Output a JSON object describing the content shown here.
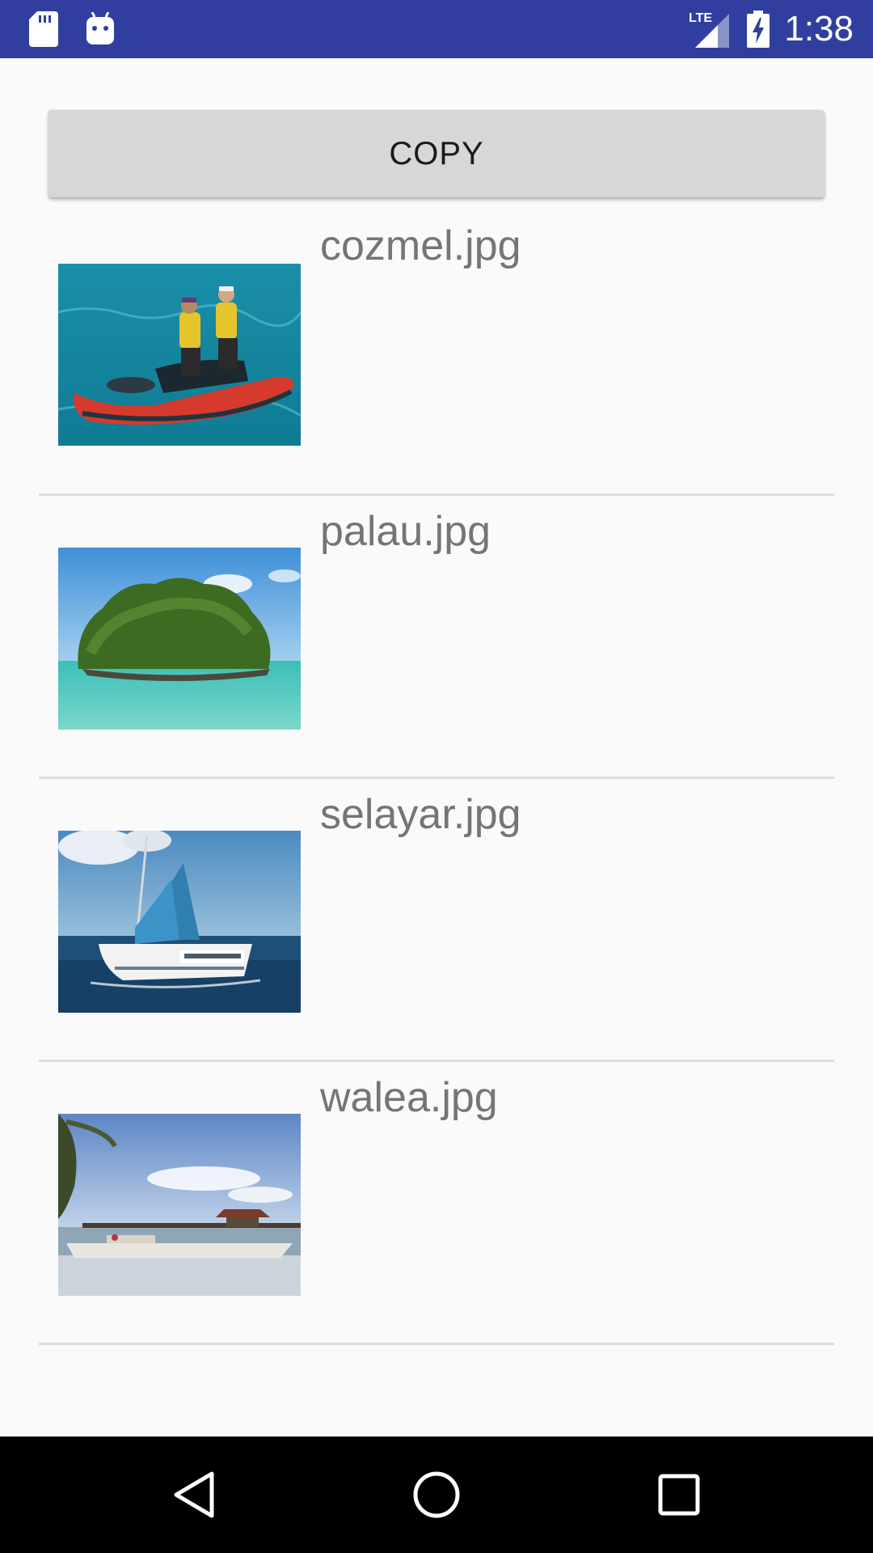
{
  "status_bar": {
    "time": "1:38",
    "network": "LTE",
    "left_icons": [
      "sd-card-icon",
      "android-debug-icon"
    ],
    "right_icons": [
      "lte-signal-icon",
      "battery-charging-icon"
    ],
    "background": "#303f9f"
  },
  "toolbar": {
    "copy_label": "COPY"
  },
  "files": [
    {
      "name": "cozmel.jpg",
      "thumbnail": "jet-ski-photo"
    },
    {
      "name": "palau.jpg",
      "thumbnail": "island-photo"
    },
    {
      "name": "selayar.jpg",
      "thumbnail": "sailboat-photo"
    },
    {
      "name": "walea.jpg",
      "thumbnail": "pier-photo"
    }
  ],
  "nav_bar": {
    "buttons": [
      "back-icon",
      "home-icon",
      "recents-icon"
    ]
  }
}
